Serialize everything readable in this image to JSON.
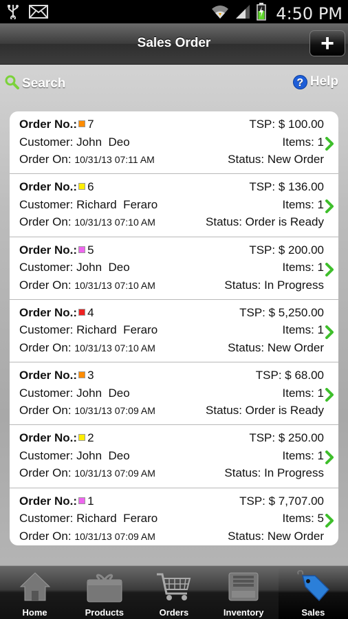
{
  "status_bar": {
    "time": "4:50 PM",
    "icons": [
      "usb-icon",
      "mail-icon",
      "wifi-icon",
      "signal-icon",
      "battery-charging-icon"
    ]
  },
  "header": {
    "title": "Sales Order",
    "add_label": "+"
  },
  "toolbar": {
    "search_label": "Search",
    "help_label": "Help",
    "help_glyph": "?"
  },
  "orders": [
    {
      "order_label": "Order No.:",
      "number": "7",
      "color": "#ff8c00",
      "tsp": "TSP: $ 100.00",
      "customer_label": "Customer:",
      "customer": "John  Deo",
      "items": "Items: 1",
      "order_on_label": "Order On:",
      "date": "10/31/13 07:11 AM",
      "status": "Status: New Order"
    },
    {
      "order_label": "Order No.:",
      "number": "6",
      "color": "#ffee00",
      "tsp": "TSP: $ 136.00",
      "customer_label": "Customer:",
      "customer": "Richard  Feraro",
      "items": "Items: 1",
      "order_on_label": "Order On:",
      "date": "10/31/13 07:10 AM",
      "status": "Status: Order is Ready"
    },
    {
      "order_label": "Order No.:",
      "number": "5",
      "color": "#ee66ee",
      "tsp": "TSP: $ 200.00",
      "customer_label": "Customer:",
      "customer": "John  Deo",
      "items": "Items: 1",
      "order_on_label": "Order On:",
      "date": "10/31/13 07:10 AM",
      "status": "Status: In Progress"
    },
    {
      "order_label": "Order No.:",
      "number": "4",
      "color": "#ee2222",
      "tsp": "TSP: $ 5,250.00",
      "customer_label": "Customer:",
      "customer": "Richard  Feraro",
      "items": "Items: 1",
      "order_on_label": "Order On:",
      "date": "10/31/13 07:10 AM",
      "status": "Status: New Order"
    },
    {
      "order_label": "Order No.:",
      "number": "3",
      "color": "#ff8c00",
      "tsp": "TSP: $ 68.00",
      "customer_label": "Customer:",
      "customer": "John  Deo",
      "items": "Items: 1",
      "order_on_label": "Order On:",
      "date": "10/31/13 07:09 AM",
      "status": "Status: Order is Ready"
    },
    {
      "order_label": "Order No.:",
      "number": "2",
      "color": "#ffee00",
      "tsp": "TSP: $ 250.00",
      "customer_label": "Customer:",
      "customer": "John  Deo",
      "items": "Items: 1",
      "order_on_label": "Order On:",
      "date": "10/31/13 07:09 AM",
      "status": "Status: In Progress"
    },
    {
      "order_label": "Order No.:",
      "number": "1",
      "color": "#ee66ee",
      "tsp": "TSP: $ 7,707.00",
      "customer_label": "Customer:",
      "customer": "Richard  Feraro",
      "items": "Items: 5",
      "order_on_label": "Order On:",
      "date": "10/31/13 07:09 AM",
      "status": "Status: New Order"
    }
  ],
  "tabs": [
    {
      "label": "Home",
      "icon": "house-icon",
      "active": false
    },
    {
      "label": "Products",
      "icon": "gift-box-icon",
      "active": false
    },
    {
      "label": "Orders",
      "icon": "shopping-cart-icon",
      "active": false
    },
    {
      "label": "Inventory",
      "icon": "storage-box-icon",
      "active": false
    },
    {
      "label": "Sales",
      "icon": "price-tag-icon",
      "active": true
    }
  ],
  "colors": {
    "chevron": "#3fbf2c",
    "help_icon": "#1e5ed8",
    "search_icon": "#7bd23a"
  }
}
